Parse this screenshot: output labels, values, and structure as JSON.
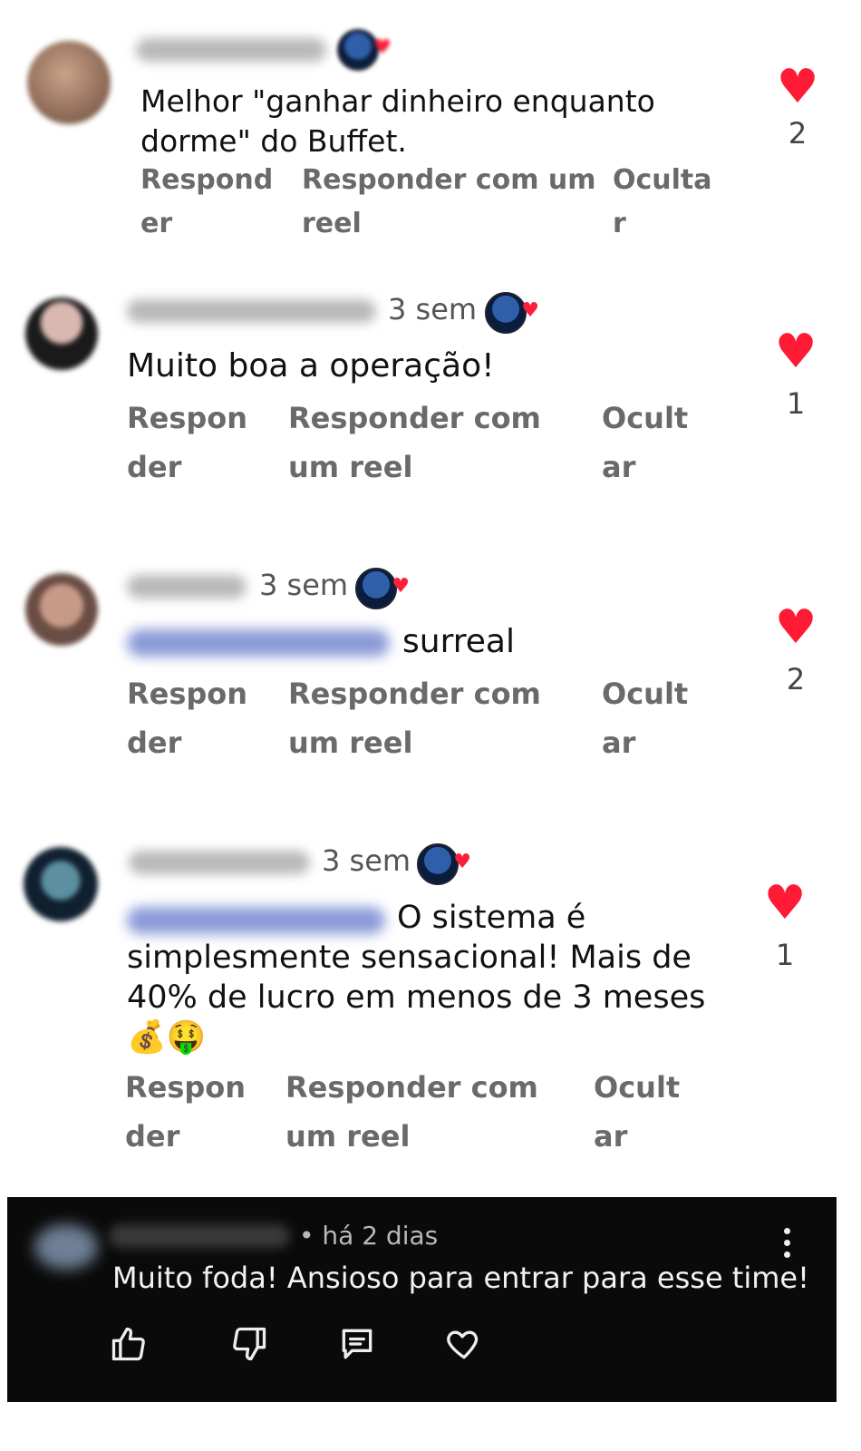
{
  "comments": [
    {
      "time": "",
      "text": "Melhor \"ganhar dinheiro enquanto\ndorme\" do Buffet.",
      "actions": {
        "reply": "Respond\ner",
        "reply_reel": "Responder com um\nreel",
        "hide": "Oculta\nr"
      },
      "likes": "2"
    },
    {
      "time": "3 sem",
      "text": "Muito boa a operação!",
      "actions": {
        "reply": "Respon\nder",
        "reply_reel": "Responder com\num reel",
        "hide": "Ocult\nar"
      },
      "likes": "1"
    },
    {
      "time": "3 sem",
      "text": "surreal",
      "actions": {
        "reply": "Respon\nder",
        "reply_reel": "Responder com\num reel",
        "hide": "Ocult\nar"
      },
      "likes": "2"
    },
    {
      "time": "3 sem",
      "text": "O sistema é\nsimplesmente sensacional! Mais de\n40% de lucro em menos de 3 meses\n💰🤑",
      "actions": {
        "reply": "Respon\nder",
        "reply_reel": "Responder com\num reel",
        "hide": "Ocult\nar"
      },
      "likes": "1"
    }
  ],
  "bottom_comment": {
    "time": "• há 2 dias",
    "text": "Muito foda! Ansioso para entrar para esse time!"
  },
  "icons": {
    "like": "thumbs-up-icon",
    "dislike": "thumbs-down-icon",
    "reply": "chat-icon",
    "heart": "heart-icon",
    "more": "more-vertical-icon"
  },
  "colors": {
    "heart": "#ff1a35",
    "dark_panel": "#0a0a0a"
  }
}
